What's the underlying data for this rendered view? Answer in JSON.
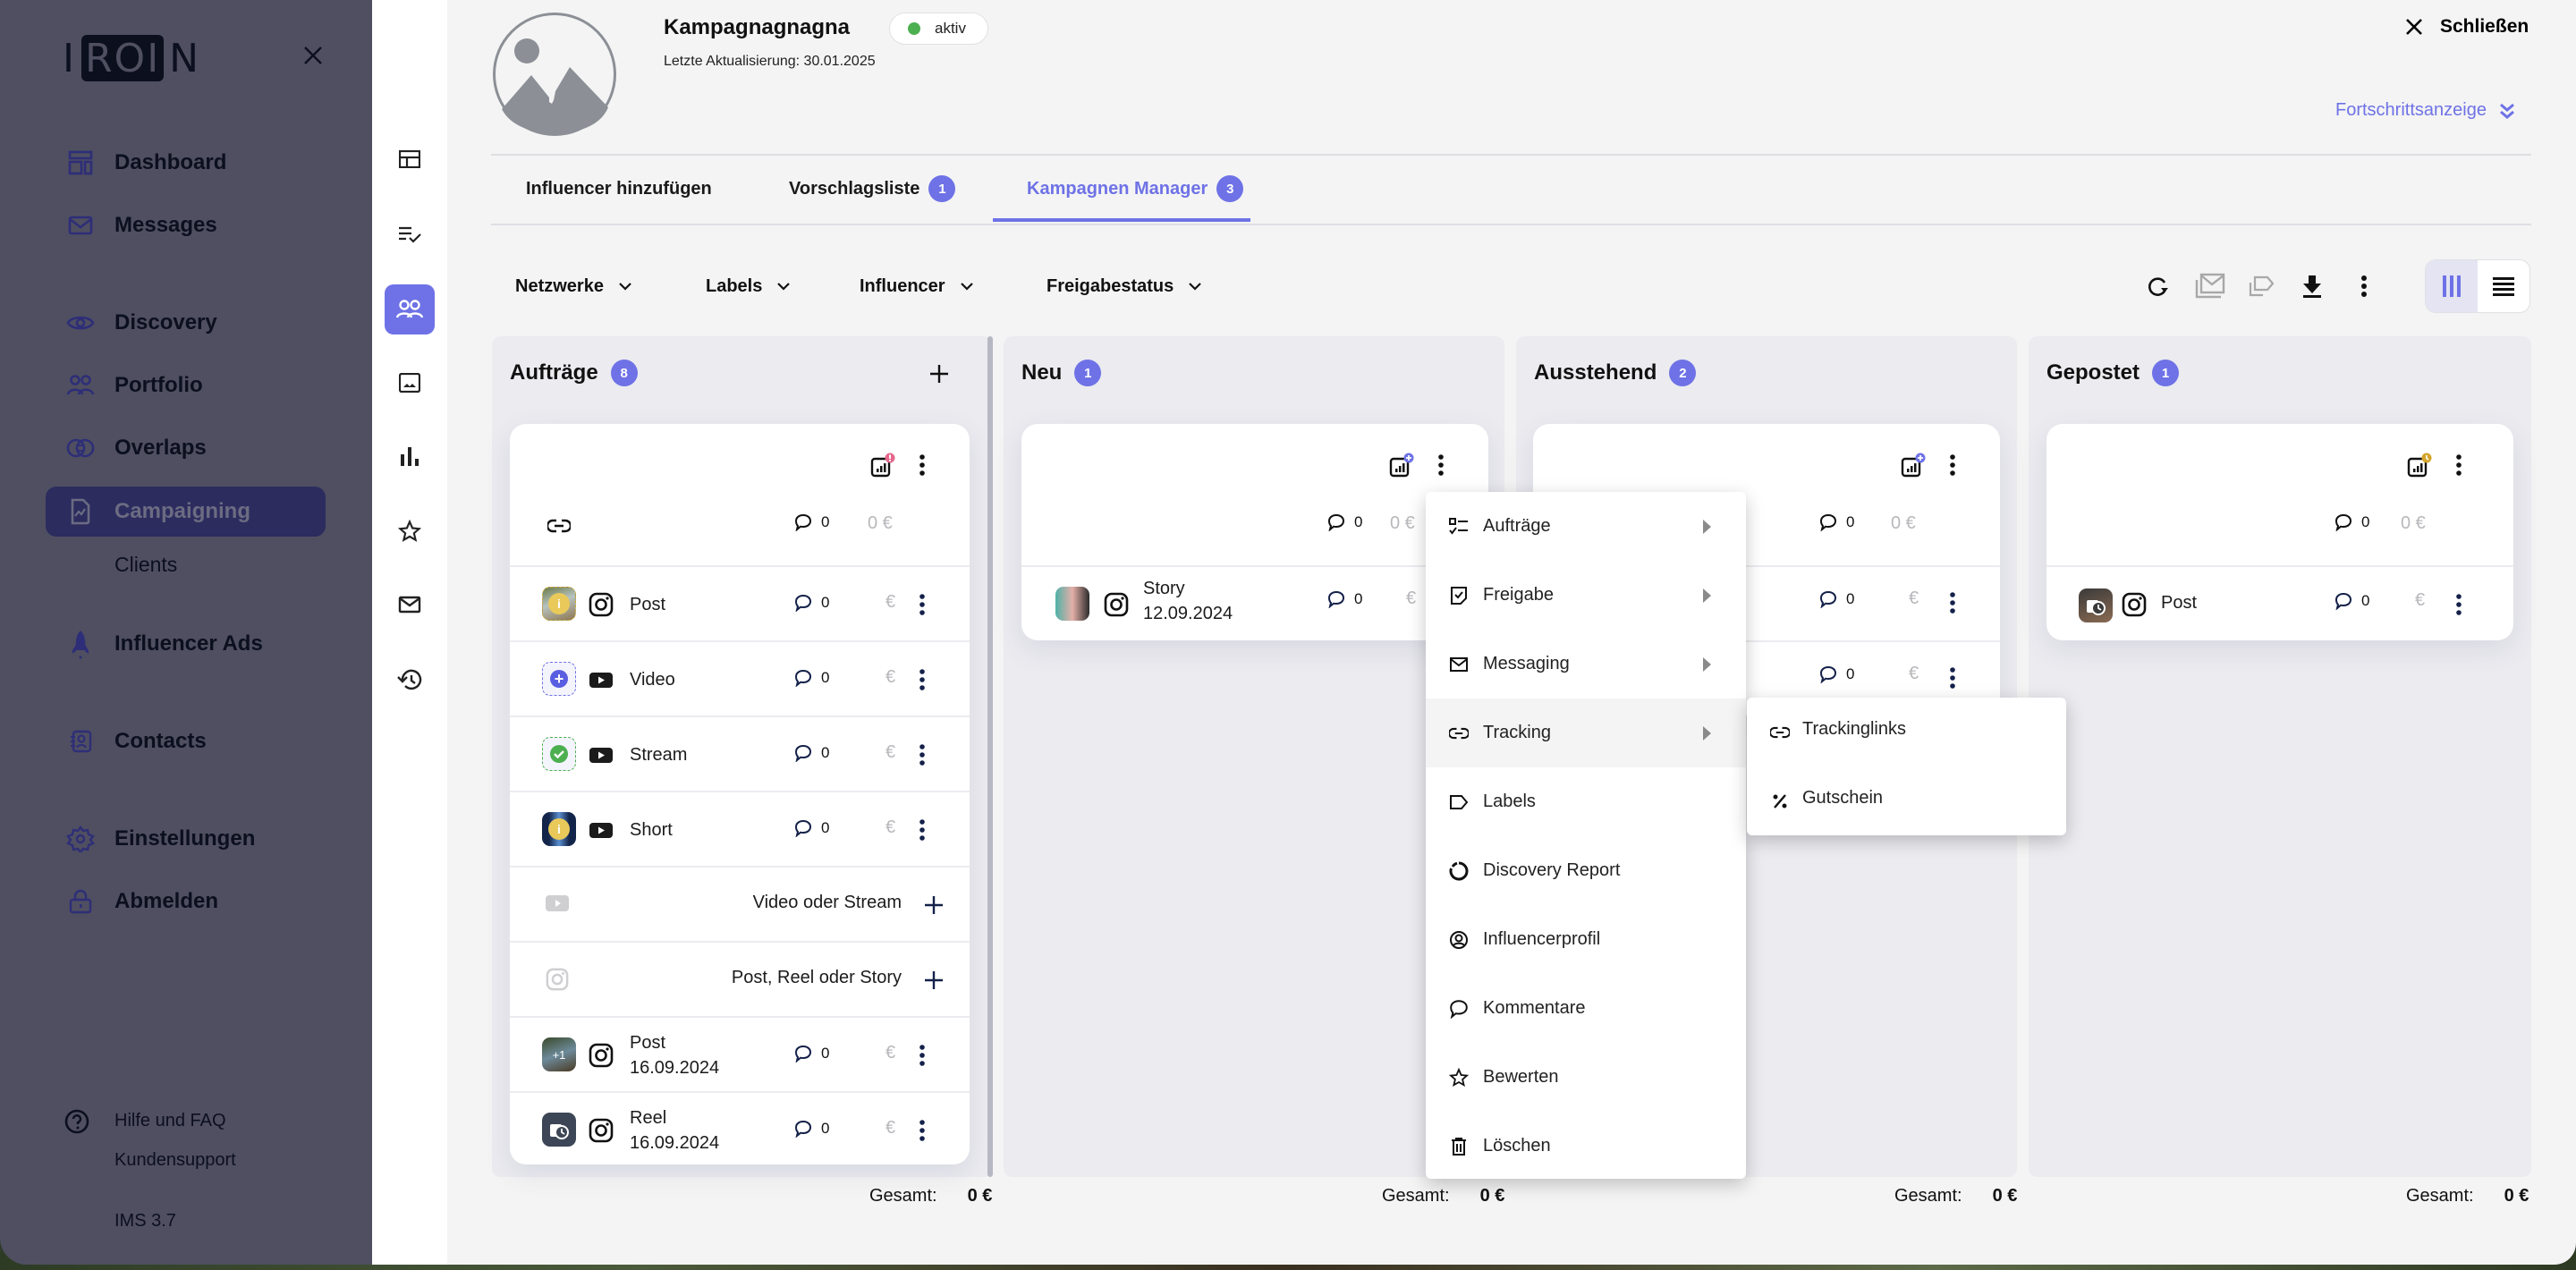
{
  "sidebar": {
    "logo": {
      "left": "I",
      "box": "ROI",
      "right": "N"
    },
    "items": [
      {
        "label": "Dashboard",
        "icon": "dashboard-icon"
      },
      {
        "label": "Messages",
        "icon": "mail-icon"
      },
      {
        "label": "Discovery",
        "icon": "eye-icon"
      },
      {
        "label": "Portfolio",
        "icon": "users-icon"
      },
      {
        "label": "Overlaps",
        "icon": "overlap-icon"
      },
      {
        "label": "Campaigning",
        "icon": "file-chart-icon",
        "active": true
      },
      {
        "label": "Influencer Ads",
        "icon": "rocket-icon"
      },
      {
        "label": "Contacts",
        "icon": "contacts-icon"
      },
      {
        "label": "Einstellungen",
        "icon": "gear-icon"
      },
      {
        "label": "Abmelden",
        "icon": "lock-icon"
      }
    ],
    "sub_items": [
      "Clients"
    ],
    "help": "Hilfe und FAQ",
    "support": "Kundensupport",
    "version": "IMS 3.7"
  },
  "rail": [
    "layout-icon",
    "checklist-icon",
    "users-icon",
    "image-icon",
    "bar-chart-icon",
    "star-icon",
    "mail-icon",
    "history-icon"
  ],
  "header": {
    "campaign_name": "Kampagnagnagna",
    "status": "aktiv",
    "status_color": "#4caf50",
    "last_update": "Letzte Aktualisierung: 30.01.2025",
    "close_label": "Schließen",
    "progress_label": "Fortschrittsanzeige"
  },
  "tabs": [
    {
      "label": "Influencer hinzufügen",
      "count": null
    },
    {
      "label": "Vorschlagsliste",
      "count": "1"
    },
    {
      "label": "Kampagnen Manager",
      "count": "3",
      "active": true
    }
  ],
  "filters": [
    "Netzwerke",
    "Labels",
    "Influencer",
    "Freigabestatus"
  ],
  "toolbar": [
    "refresh-icon",
    "bulk-mail-icon",
    "bulk-label-icon",
    "download-icon",
    "more-icon"
  ],
  "accent": "#6e72e6",
  "columns": [
    {
      "title": "Aufträge",
      "count": "8",
      "total_label": "Gesamt:",
      "total": "0 €",
      "summary": {
        "comments": "0",
        "price": "0 €"
      },
      "rows": [
        {
          "label": "Post",
          "date": "",
          "network": "instagram",
          "comments": "0",
          "price": "€"
        },
        {
          "label": "Video",
          "date": "",
          "network": "youtube",
          "comments": "0",
          "price": "€"
        },
        {
          "label": "Stream",
          "date": "",
          "network": "youtube",
          "comments": "0",
          "price": "€"
        },
        {
          "label": "Short",
          "date": "",
          "network": "youtube",
          "comments": "0",
          "price": "€"
        }
      ],
      "add_rows": [
        "Video oder Stream",
        "Post, Reel oder Story"
      ],
      "dated_rows": [
        {
          "label": "Post",
          "date": "16.09.2024",
          "badge": "+1",
          "comments": "0",
          "price": "€"
        },
        {
          "label": "Reel",
          "date": "16.09.2024",
          "comments": "0",
          "price": "€"
        }
      ]
    },
    {
      "title": "Neu",
      "count": "1",
      "total_label": "Gesamt:",
      "total": "0 €",
      "summary": {
        "comments": "0",
        "price": "0 €"
      },
      "rows": [
        {
          "label": "Story",
          "date": "12.09.2024",
          "comments": "0",
          "price": "€"
        }
      ]
    },
    {
      "title": "Ausstehend",
      "count": "2",
      "total_label": "Gesamt:",
      "total": "0 €",
      "summary": {
        "comments": "0",
        "price": "0 €"
      },
      "rows": [
        {
          "comments": "0",
          "price": "€"
        },
        {
          "comments": "0",
          "price": "€"
        }
      ]
    },
    {
      "title": "Gepostet",
      "count": "1",
      "total_label": "Gesamt:",
      "total": "0 €",
      "summary": {
        "comments": "0",
        "price": "0 €"
      },
      "rows": [
        {
          "label": "Post",
          "comments": "0",
          "price": "€"
        }
      ]
    }
  ],
  "context_menu": {
    "items": [
      {
        "label": "Aufträge",
        "icon": "checklist-icon",
        "submenu": true
      },
      {
        "label": "Freigabe",
        "icon": "approval-icon",
        "submenu": true
      },
      {
        "label": "Messaging",
        "icon": "mail-icon",
        "submenu": true
      },
      {
        "label": "Tracking",
        "icon": "link-icon",
        "submenu": true,
        "hover": true
      },
      {
        "label": "Labels",
        "icon": "label-icon"
      },
      {
        "label": "Discovery Report",
        "icon": "donut-icon"
      },
      {
        "label": "Influencerprofil",
        "icon": "profile-icon"
      },
      {
        "label": "Kommentare",
        "icon": "comment-icon"
      },
      {
        "label": "Bewerten",
        "icon": "star-icon"
      },
      {
        "label": "Löschen",
        "icon": "trash-icon"
      }
    ],
    "submenu": [
      {
        "label": "Trackinglinks",
        "icon": "link-icon"
      },
      {
        "label": "Gutschein",
        "icon": "percent-icon"
      }
    ]
  }
}
